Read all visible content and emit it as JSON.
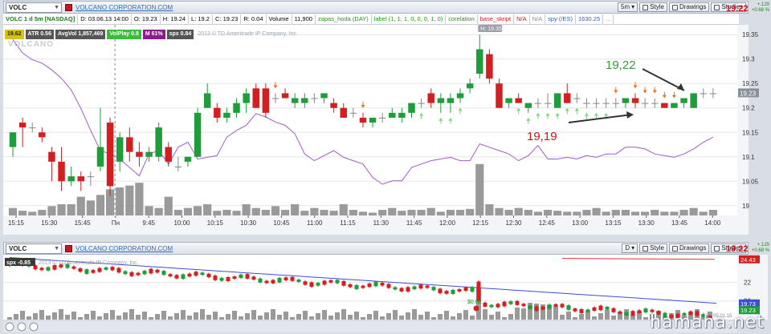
{
  "top": {
    "symbol": "VOLC",
    "company": "VOLCANO CORPORATION.COM",
    "timeframe": "5m",
    "style_label": "Style",
    "drawings_label": "Drawings",
    "studies_label": "Studies",
    "last_price": "19.22",
    "change_abs": "+.129",
    "change_pct": "+0.68 %",
    "info": {
      "title": "VOLC 1 d 5m [NASDAQ]",
      "date": "D: 03.06.13 14:00",
      "open": "O: 19.23",
      "high": "H: 19.24",
      "low": "L: 19.2",
      "close": "C: 19.23",
      "range": "R: 0.04",
      "volume_label": "Volume",
      "volume": "11,900",
      "study1": "zapas_hoda (DAY)",
      "study2": "label (1, 1, 1, 0, 0, 0, 1, 0)",
      "study3": "corelation",
      "study4": "base_skript",
      "na": "N/A",
      "na2": "N/A",
      "spy": "spy (/ES)",
      "spy_val": "1630.25",
      "tail": "..."
    },
    "studies": {
      "price": "19.62",
      "atr": "ATR 0.56",
      "avgvol": "AvgVol 1,857,469",
      "volplay": "VolPlay 0.8",
      "m": "M 61%",
      "spx": "spx 0.84",
      "copyright": "2013 © TD Ameritrade IP Company, Inc."
    },
    "watermark": "VOLCANO",
    "hi_label": "H: 19.35",
    "price_tag": "19.23",
    "annotations": {
      "a1": "19,22",
      "a2": "19,19"
    },
    "y_ticks": [
      "19.35",
      "19.3",
      "19.25",
      "19.2",
      "19.15",
      "19.1",
      "19.05",
      "19"
    ],
    "x_ticks": [
      "15:15",
      "15:30",
      "15:45",
      "Пн",
      "9:45",
      "10:00",
      "10:15",
      "10:30",
      "10:45",
      "11:00",
      "11:15",
      "11:30",
      "11:45",
      "12:00",
      "12:15",
      "12:30",
      "12:45",
      "13:00",
      "13:15",
      "13:30",
      "13:45",
      "14:00"
    ]
  },
  "bottom": {
    "symbol": "VOLC",
    "company": "VOLCANO CORPORATION.COM",
    "timeframe": "D",
    "style_label": "Style",
    "drawings_label": "Drawings",
    "studies_label": "Studies",
    "last_price": "19.22",
    "change_abs": "+.129",
    "change_pct": "+0.68 %",
    "spx_badge": "spx -0.85",
    "copyright": "2013 © TD Ameritrade IP Company, Inc.",
    "dividend_label": "$0.02",
    "tags": {
      "red": "24.43",
      "blue": "19.73",
      "green": "19.23"
    },
    "y_ticks": [
      "22",
      "20"
    ],
    "date_right": "05.01.15"
  },
  "site": "hamaha.net",
  "colors": {
    "up": "#1f9d3a",
    "down": "#d31f1f",
    "volume": "#9a9a9a",
    "corr": "#a15cc6",
    "arrow_up": "#7ed67e",
    "arrow_down": "#f07020"
  },
  "chart_data": {
    "type": "candlestick",
    "ylim": [
      18.98,
      19.37
    ],
    "candles": [
      {
        "o": 19.12,
        "h": 19.15,
        "l": 19.1,
        "c": 19.15
      },
      {
        "o": 19.17,
        "h": 19.18,
        "l": 19.12,
        "c": 19.16
      },
      {
        "o": 19.16,
        "h": 19.17,
        "l": 19.15,
        "c": 19.16
      },
      {
        "o": 19.15,
        "h": 19.16,
        "l": 19.13,
        "c": 19.14
      },
      {
        "o": 19.11,
        "h": 19.12,
        "l": 19.05,
        "c": 19.09
      },
      {
        "o": 19.09,
        "h": 19.12,
        "l": 19.03,
        "c": 19.05
      },
      {
        "o": 19.05,
        "h": 19.08,
        "l": 19.04,
        "c": 19.06
      },
      {
        "o": 19.06,
        "h": 19.07,
        "l": 19.03,
        "c": 19.05
      },
      {
        "o": 19.06,
        "h": 19.07,
        "l": 19.04,
        "c": 19.06
      },
      {
        "o": 19.08,
        "h": 19.2,
        "l": 19.07,
        "c": 19.12
      },
      {
        "o": 19.17,
        "h": 19.18,
        "l": 19.02,
        "c": 19.04
      },
      {
        "o": 19.09,
        "h": 19.15,
        "l": 19.07,
        "c": 19.14
      },
      {
        "o": 19.14,
        "h": 19.16,
        "l": 19.09,
        "c": 19.11
      },
      {
        "o": 19.11,
        "h": 19.13,
        "l": 19.08,
        "c": 19.1
      },
      {
        "o": 19.1,
        "h": 19.12,
        "l": 19.09,
        "c": 19.11
      },
      {
        "o": 19.1,
        "h": 19.17,
        "l": 19.09,
        "c": 19.16
      },
      {
        "o": 19.12,
        "h": 19.13,
        "l": 19.08,
        "c": 19.09
      },
      {
        "o": 19.08,
        "h": 19.1,
        "l": 19.07,
        "c": 19.08
      },
      {
        "o": 19.09,
        "h": 19.1,
        "l": 19.08,
        "c": 19.1
      },
      {
        "o": 19.1,
        "h": 19.2,
        "l": 19.1,
        "c": 19.19
      },
      {
        "o": 19.2,
        "h": 19.25,
        "l": 19.2,
        "c": 19.23
      },
      {
        "o": 19.2,
        "h": 19.21,
        "l": 19.17,
        "c": 19.18
      },
      {
        "o": 19.18,
        "h": 19.2,
        "l": 19.17,
        "c": 19.19
      },
      {
        "o": 19.19,
        "h": 19.22,
        "l": 19.18,
        "c": 19.21
      },
      {
        "o": 19.21,
        "h": 19.24,
        "l": 19.19,
        "c": 19.23
      },
      {
        "o": 19.24,
        "h": 19.25,
        "l": 19.2,
        "c": 19.2
      },
      {
        "o": 19.24,
        "h": 19.25,
        "l": 19.18,
        "c": 19.19
      },
      {
        "o": 19.22,
        "h": 19.23,
        "l": 19.21,
        "c": 19.22
      },
      {
        "o": 19.23,
        "h": 19.24,
        "l": 19.22,
        "c": 19.22
      },
      {
        "o": 19.21,
        "h": 19.23,
        "l": 19.2,
        "c": 19.22
      },
      {
        "o": 19.21,
        "h": 19.23,
        "l": 19.2,
        "c": 19.22
      },
      {
        "o": 19.22,
        "h": 19.23,
        "l": 19.21,
        "c": 19.22
      },
      {
        "o": 19.22,
        "h": 19.23,
        "l": 19.21,
        "c": 19.23
      },
      {
        "o": 19.21,
        "h": 19.22,
        "l": 19.19,
        "c": 19.2
      },
      {
        "o": 19.2,
        "h": 19.21,
        "l": 19.18,
        "c": 19.18
      },
      {
        "o": 19.19,
        "h": 19.2,
        "l": 19.18,
        "c": 19.19
      },
      {
        "o": 19.18,
        "h": 19.19,
        "l": 19.16,
        "c": 19.17
      },
      {
        "o": 19.17,
        "h": 19.18,
        "l": 19.16,
        "c": 19.18
      },
      {
        "o": 19.18,
        "h": 19.19,
        "l": 19.17,
        "c": 19.18
      },
      {
        "o": 19.18,
        "h": 19.2,
        "l": 19.18,
        "c": 19.19
      },
      {
        "o": 19.18,
        "h": 19.2,
        "l": 19.17,
        "c": 19.19
      },
      {
        "o": 19.19,
        "h": 19.21,
        "l": 19.18,
        "c": 19.21
      },
      {
        "o": 19.21,
        "h": 19.22,
        "l": 19.2,
        "c": 19.21
      },
      {
        "o": 19.23,
        "h": 19.24,
        "l": 19.2,
        "c": 19.21
      },
      {
        "o": 19.21,
        "h": 19.23,
        "l": 19.19,
        "c": 19.22
      },
      {
        "o": 19.21,
        "h": 19.23,
        "l": 19.19,
        "c": 19.22
      },
      {
        "o": 19.22,
        "h": 19.24,
        "l": 19.21,
        "c": 19.23
      },
      {
        "o": 19.24,
        "h": 19.26,
        "l": 19.23,
        "c": 19.25
      },
      {
        "o": 19.27,
        "h": 19.35,
        "l": 19.26,
        "c": 19.32
      },
      {
        "o": 19.31,
        "h": 19.32,
        "l": 19.25,
        "c": 19.26
      },
      {
        "o": 19.25,
        "h": 19.26,
        "l": 19.2,
        "c": 19.2
      },
      {
        "o": 19.21,
        "h": 19.22,
        "l": 19.2,
        "c": 19.22
      },
      {
        "o": 19.22,
        "h": 19.23,
        "l": 19.21,
        "c": 19.21
      },
      {
        "o": 19.2,
        "h": 19.21,
        "l": 19.19,
        "c": 19.21
      },
      {
        "o": 19.21,
        "h": 19.22,
        "l": 19.2,
        "c": 19.21
      },
      {
        "o": 19.21,
        "h": 19.23,
        "l": 19.2,
        "c": 19.21
      },
      {
        "o": 19.2,
        "h": 19.23,
        "l": 19.2,
        "c": 19.23
      },
      {
        "o": 19.23,
        "h": 19.25,
        "l": 19.21,
        "c": 19.21
      },
      {
        "o": 19.22,
        "h": 19.23,
        "l": 19.21,
        "c": 19.22
      },
      {
        "o": 19.21,
        "h": 19.22,
        "l": 19.2,
        "c": 19.21
      },
      {
        "o": 19.21,
        "h": 19.22,
        "l": 19.2,
        "c": 19.21
      },
      {
        "o": 19.21,
        "h": 19.22,
        "l": 19.2,
        "c": 19.21
      },
      {
        "o": 19.21,
        "h": 19.22,
        "l": 19.2,
        "c": 19.21
      },
      {
        "o": 19.21,
        "h": 19.22,
        "l": 19.2,
        "c": 19.22
      },
      {
        "o": 19.22,
        "h": 19.23,
        "l": 19.2,
        "c": 19.21
      },
      {
        "o": 19.21,
        "h": 19.22,
        "l": 19.2,
        "c": 19.21
      },
      {
        "o": 19.21,
        "h": 19.22,
        "l": 19.2,
        "c": 19.21
      },
      {
        "o": 19.21,
        "h": 19.21,
        "l": 19.2,
        "c": 19.2
      },
      {
        "o": 19.2,
        "h": 19.21,
        "l": 19.2,
        "c": 19.21
      },
      {
        "o": 19.21,
        "h": 19.22,
        "l": 19.2,
        "c": 19.22
      },
      {
        "o": 19.2,
        "h": 19.23,
        "l": 19.2,
        "c": 19.23
      },
      {
        "o": 19.23,
        "h": 19.24,
        "l": 19.22,
        "c": 19.23
      },
      {
        "o": 19.23,
        "h": 19.24,
        "l": 19.22,
        "c": 19.23
      }
    ],
    "volume": [
      8,
      5,
      4,
      6,
      10,
      12,
      12,
      20,
      16,
      22,
      28,
      30,
      32,
      35,
      10,
      8,
      20,
      6,
      8,
      10,
      12,
      5,
      6,
      5,
      12,
      8,
      6,
      10,
      6,
      12,
      5,
      8,
      6,
      5,
      12,
      6,
      4,
      3,
      6,
      8,
      5,
      6,
      6,
      8,
      4,
      6,
      6,
      7,
      55,
      12,
      8,
      6,
      8,
      6,
      4,
      6,
      5,
      4,
      4,
      6,
      8,
      4,
      6,
      6,
      4,
      4,
      6,
      4,
      4,
      6,
      8,
      4,
      6
    ],
    "correlation": [
      0.96,
      0.88,
      0.84,
      0.82,
      0.78,
      0.73,
      0.66,
      0.55,
      0.42,
      0.3,
      0.28,
      0.25,
      0.2,
      0.15,
      0.28,
      0.3,
      0.22,
      0.32,
      0.35,
      0.25,
      0.26,
      0.27,
      0.38,
      0.42,
      0.45,
      0.52,
      0.5,
      0.47,
      0.45,
      0.4,
      0.28,
      0.24,
      0.27,
      0.3,
      0.26,
      0.24,
      0.22,
      0.14,
      0.1,
      0.12,
      0.12,
      0.2,
      0.22,
      0.24,
      0.25,
      0.26,
      0.24,
      0.24,
      0.34,
      0.32,
      0.3,
      0.28,
      0.24,
      0.27,
      0.33,
      0.25,
      0.25,
      0.26,
      0.25,
      0.27,
      0.26,
      0.28,
      0.28,
      0.32,
      0.32,
      0.31,
      0.28,
      0.27,
      0.26,
      0.28,
      0.31,
      0.35,
      0.38
    ],
    "y_ticks": [
      19.35,
      19.3,
      19.25,
      19.2,
      19.15,
      19.1,
      19.05,
      19.0
    ]
  }
}
